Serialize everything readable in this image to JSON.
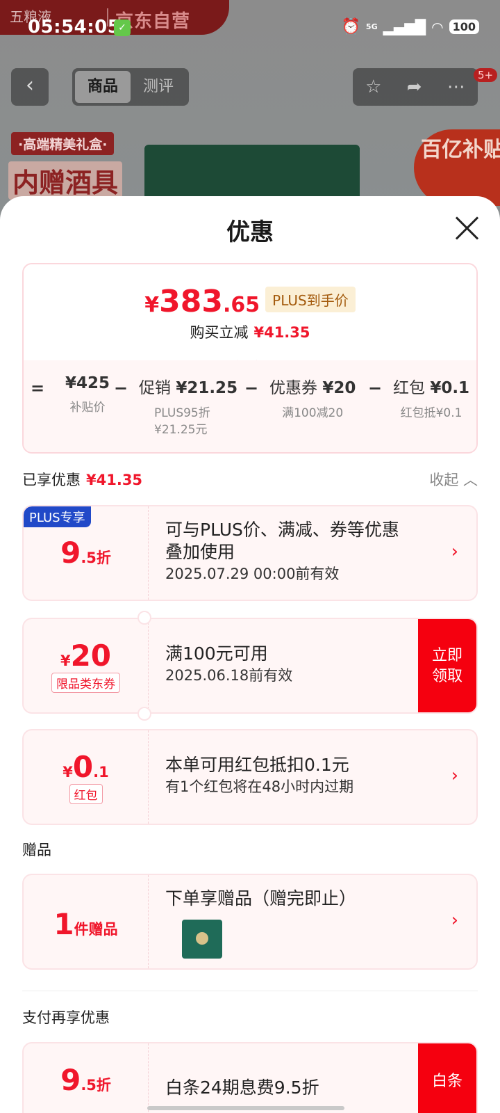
{
  "status_bar": {
    "time": "05:54:05",
    "network": "5G",
    "battery": "100"
  },
  "background_page": {
    "brand_left": "五粮液",
    "brand_right": "京东自营",
    "tabs": [
      "商品",
      "测评"
    ],
    "active_tab": "商品",
    "cart_badge": "5+",
    "gift_tag": "·高端精美礼盒·",
    "gift_headline": "内赠酒具",
    "subsidy_badge": "百亿补贴"
  },
  "sheet": {
    "title": "优惠",
    "summary": {
      "currency": "¥",
      "price_int": "383",
      "price_dec": ".65",
      "plus_tag": "PLUS到手价",
      "reduce_label": "购买立减",
      "reduce_amount": "¥41.35",
      "calc": [
        {
          "op": "=",
          "label": "",
          "value": "¥425",
          "sub": "补贴价"
        },
        {
          "op": "−",
          "label": "促销",
          "value": "¥21.25",
          "sub": "PLUS95折",
          "sub2": "¥21.25元"
        },
        {
          "op": "−",
          "label": "优惠券",
          "value": "¥20",
          "sub": "满100减20"
        },
        {
          "op": "−",
          "label": "红包",
          "value": "¥0.1",
          "sub": "红包抵¥0.1"
        }
      ]
    },
    "enjoyed": {
      "label": "已享优惠",
      "amount": "¥41.35",
      "collapse": "收起"
    },
    "cards": {
      "plus": {
        "badge": "PLUS专享",
        "big": "9",
        "small": ".5折",
        "line1a": "可与PLUS价、满减、券等优惠",
        "line1b": "叠加使用",
        "line2": "2025.07.29 00:00前有效"
      },
      "coupon": {
        "currency": "¥",
        "big": "20",
        "tag": "限品类东券",
        "line1": "满100元可用",
        "line2": "2025.06.18前有效",
        "claim_a": "立即",
        "claim_b": "领取"
      },
      "redpacket": {
        "currency": "¥",
        "big": "0",
        "small": ".1",
        "tag": "红包",
        "line1": "本单可用红包抵扣0.1元",
        "line2": "有1个红包将在48小时内过期"
      }
    },
    "gift_section": {
      "label": "赠品",
      "count": "1",
      "count_unit": "件赠品",
      "line1": "下单享赠品（赠完即止）"
    },
    "pay_section": {
      "label": "支付再享优惠",
      "big": "9",
      "small": ".5折",
      "line1": "白条24期息费9.5折",
      "side": "白条"
    }
  },
  "colors": {
    "accent_red": "#f0162b",
    "plus_blue": "#2149c8",
    "plus_gold_bg": "#fbefd5"
  }
}
